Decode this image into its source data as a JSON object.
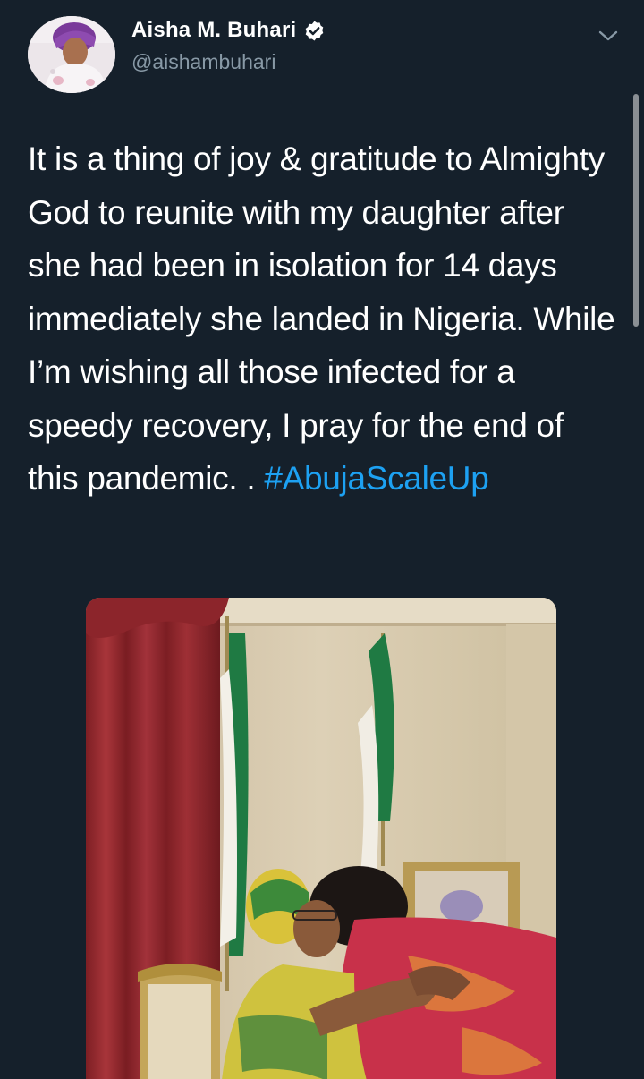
{
  "tweet": {
    "display_name": "Aisha M. Buhari",
    "handle": "@aishambuhari",
    "verified": true,
    "text": "It is a thing of joy & gratitude to Almighty God to reunite with my daughter after she had been in isolation for 14 days immediately she landed in Nigeria. While I’m wishing all those infected for a speedy recovery, I pray for the end of this pandemic. . ",
    "hashtag": "#AbujaScaleUp"
  },
  "icons": {
    "verified": "verified-badge-icon",
    "menu": "chevron-down-icon"
  },
  "colors": {
    "background": "#15202b",
    "text": "#ffffff",
    "secondary_text": "#8899a6",
    "link": "#1da1f2"
  }
}
